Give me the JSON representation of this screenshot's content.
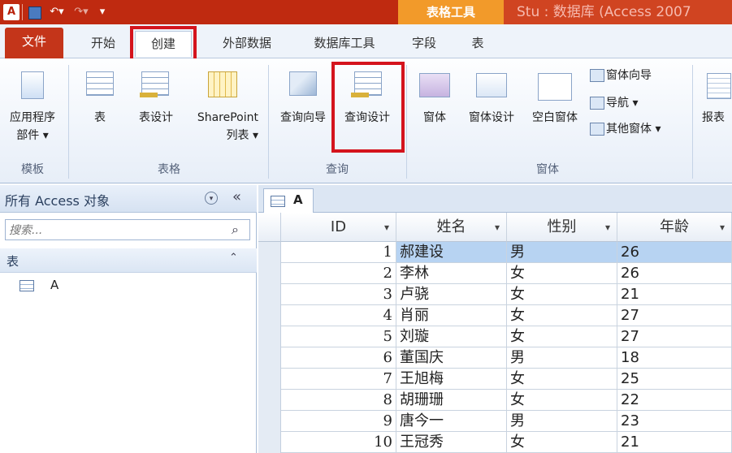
{
  "titlebar": {
    "logo": "A",
    "context_tab": "表格工具",
    "title": "Stu : 数据库 (Access 2007"
  },
  "tabs": [
    "文件",
    "开始",
    "创建",
    "外部数据",
    "数据库工具",
    "字段",
    "表"
  ],
  "ribbon": {
    "groups": [
      {
        "label": "模板",
        "buttons": [
          {
            "label": "应用程序\n部件 ▾",
            "icon": "app-parts-icon"
          }
        ]
      },
      {
        "label": "表格",
        "buttons": [
          {
            "label": "表",
            "icon": "table-icon"
          },
          {
            "label": "表设计",
            "icon": "table-design-icon"
          },
          {
            "label": "SharePoint\n列表 ▾",
            "icon": "sharepoint-list-icon"
          }
        ]
      },
      {
        "label": "查询",
        "buttons": [
          {
            "label": "查询向导",
            "icon": "query-wizard-icon"
          },
          {
            "label": "查询设计",
            "icon": "query-design-icon"
          }
        ]
      },
      {
        "label": "窗体",
        "buttons": [
          {
            "label": "窗体",
            "icon": "form-icon"
          },
          {
            "label": "窗体设计",
            "icon": "form-design-icon"
          },
          {
            "label": "空白窗体",
            "icon": "blank-form-icon"
          }
        ],
        "small": [
          "窗体向导",
          "导航 ▾",
          "其他窗体 ▾"
        ]
      },
      {
        "label": "",
        "buttons": [
          {
            "label": "报表",
            "icon": "report-icon"
          }
        ]
      }
    ]
  },
  "nav": {
    "title": "所有 Access 对象",
    "search_placeholder": "搜索...",
    "group": "表",
    "items": [
      "A"
    ]
  },
  "doc_tab": "A",
  "table": {
    "columns": [
      "ID",
      "姓名",
      "性别",
      "年龄"
    ],
    "rows": [
      [
        "1",
        "郝建设",
        "男",
        "26"
      ],
      [
        "2",
        "李林",
        "女",
        "26"
      ],
      [
        "3",
        "卢骁",
        "女",
        "21"
      ],
      [
        "4",
        "肖丽",
        "女",
        "27"
      ],
      [
        "5",
        "刘璇",
        "女",
        "27"
      ],
      [
        "6",
        "董国庆",
        "男",
        "18"
      ],
      [
        "7",
        "王旭梅",
        "女",
        "25"
      ],
      [
        "8",
        "胡珊珊",
        "女",
        "22"
      ],
      [
        "9",
        "唐今一",
        "男",
        "23"
      ],
      [
        "10",
        "王冠秀",
        "女",
        "21"
      ]
    ]
  }
}
